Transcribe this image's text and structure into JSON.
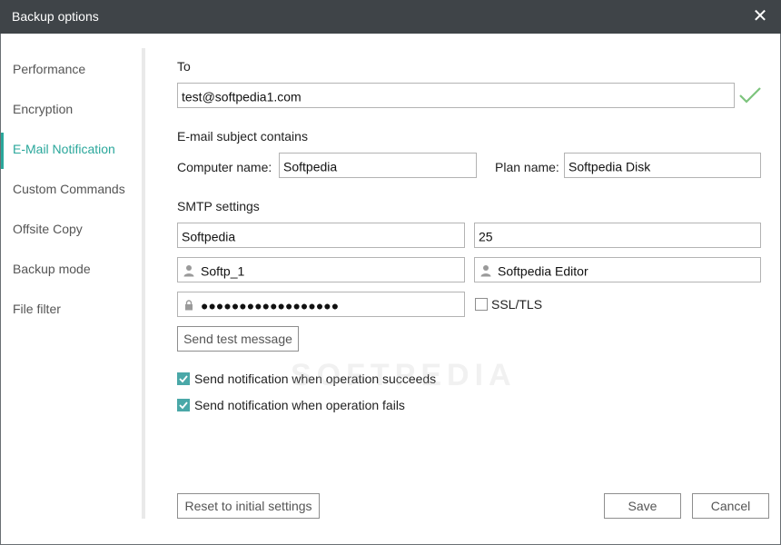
{
  "window": {
    "title": "Backup options"
  },
  "sidebar": {
    "items": [
      {
        "label": "Performance"
      },
      {
        "label": "Encryption"
      },
      {
        "label": "E-Mail Notification"
      },
      {
        "label": "Custom Commands"
      },
      {
        "label": "Offsite Copy"
      },
      {
        "label": "Backup mode"
      },
      {
        "label": "File filter"
      }
    ],
    "active_index": 2
  },
  "form": {
    "to_label": "To",
    "to_value": "test@softpedia1.com",
    "subject_label": "E-mail subject contains",
    "computer_name_label": "Computer name:",
    "computer_name_value": "Softpedia",
    "plan_name_label": "Plan name:",
    "plan_name_value": "Softpedia Disk",
    "smtp_label": "SMTP settings",
    "smtp_server_value": "Softpedia",
    "smtp_port_value": "25",
    "smtp_user_value": "Softp_1",
    "smtp_sender_value": "Softpedia Editor",
    "smtp_password_value": "●●●●●●●●●●●●●●●●●●",
    "ssl_label": "SSL/TLS",
    "ssl_checked": false,
    "send_test_label": "Send test message",
    "notify_success_label": "Send notification when operation succeeds",
    "notify_success_checked": true,
    "notify_fail_label": "Send notification when operation fails",
    "notify_fail_checked": true
  },
  "footer": {
    "reset_label": "Reset to initial settings",
    "save_label": "Save",
    "cancel_label": "Cancel"
  },
  "watermark_text": "SOFTPEDIA",
  "colors": {
    "accent": "#2aa79b",
    "titlebar": "#3f4448",
    "valid_check": "#7cc47c",
    "checkbox": "#4aa8a8"
  },
  "icons": {
    "close": "close-icon",
    "valid": "checkmark-icon",
    "user": "user-icon",
    "lock": "lock-icon"
  }
}
